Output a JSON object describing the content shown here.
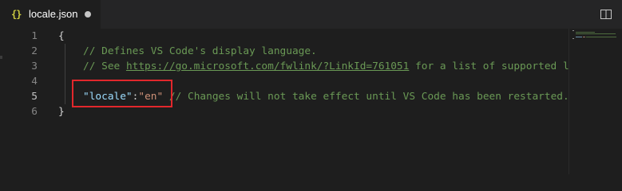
{
  "tab": {
    "icon_glyph": "{}",
    "icon": "json-braces-icon",
    "file_name": "locale.json",
    "dirty_indicator": "dirty-dot-icon"
  },
  "toolbar": {
    "split_editor_icon": "split-editor-icon"
  },
  "editor": {
    "active_line": 5,
    "line_numbers": [
      "1",
      "2",
      "3",
      "4",
      "5",
      "6"
    ],
    "lines": {
      "l1": {
        "brace": "{"
      },
      "l2": {
        "comment": "// Defines VS Code's display language."
      },
      "l3": {
        "comment_prefix": "// See ",
        "link": "https://go.microsoft.com/fwlink/?LinkId=761051",
        "comment_suffix": " for a list of supported l"
      },
      "l5": {
        "key": "\"locale\"",
        "colon": ":",
        "value": "\"en\"",
        "comment": " // Changes will not take effect until VS Code has been restarted."
      },
      "l6": {
        "brace": "}"
      }
    }
  },
  "colors": {
    "background": "#1e1e1e",
    "comment": "#6a9955",
    "key": "#9cdcfe",
    "string": "#ce9178",
    "highlight_box": "#e2272c"
  }
}
